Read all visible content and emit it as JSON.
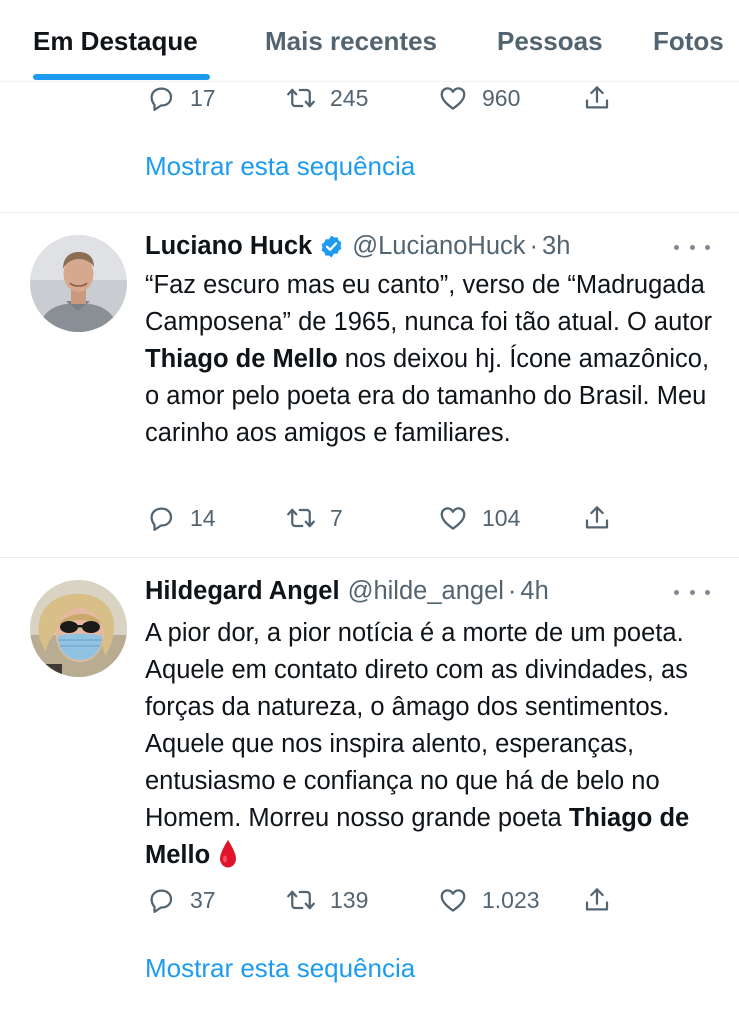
{
  "tabs": [
    {
      "label": "Em Destaque",
      "active": true
    },
    {
      "label": "Mais recentes",
      "active": false
    },
    {
      "label": "Pessoas",
      "active": false
    },
    {
      "label": "Fotos",
      "active": false
    }
  ],
  "top_tweet": {
    "replies": "17",
    "retweets": "245",
    "likes": "960",
    "show_thread": "Mostrar esta sequência"
  },
  "tweets": [
    {
      "name": "Luciano Huck",
      "verified": true,
      "handle": "@LucianoHuck",
      "separator": "·",
      "time": "3h",
      "text_part1": "“Faz escuro mas eu canto”, verso de “Madrugada Camposena” de 1965, nunca foi tão atual. O autor ",
      "text_bold": "Thiago de Mello",
      "text_part2": " nos deixou hj. Ícone amazônico, o amor pelo poeta era do tamanho do Brasil. Meu carinho aos amigos e familiares.",
      "replies": "14",
      "retweets": "7",
      "likes": "104"
    },
    {
      "name": "Hildegard Angel",
      "verified": false,
      "handle": "@hilde_angel",
      "separator": "·",
      "time": "4h",
      "text_part1": "A pior dor, a pior notícia é a morte de um poeta. Aquele em contato direto com as divindades, as forças da natureza, o âmago dos sentimentos. Aquele que nos inspira alento, esperanças, entusiasmo e confiança no que há de belo no Homem. Morreu nosso grande poeta ",
      "text_bold": "Thiago de Mello",
      "emoji": "drop-of-blood-icon",
      "replies": "37",
      "retweets": "139",
      "likes": "1.023",
      "show_thread": "Mostrar esta sequência"
    }
  ],
  "colors": {
    "accent": "#1d9bf0",
    "text": "#0f1419",
    "muted": "#536471",
    "divider": "#e6ecf0",
    "drop": "#e0152b"
  },
  "icons": [
    "reply-icon",
    "retweet-icon",
    "like-icon",
    "share-icon",
    "verified-badge-icon",
    "more-options-icon",
    "drop-of-blood-icon"
  ]
}
